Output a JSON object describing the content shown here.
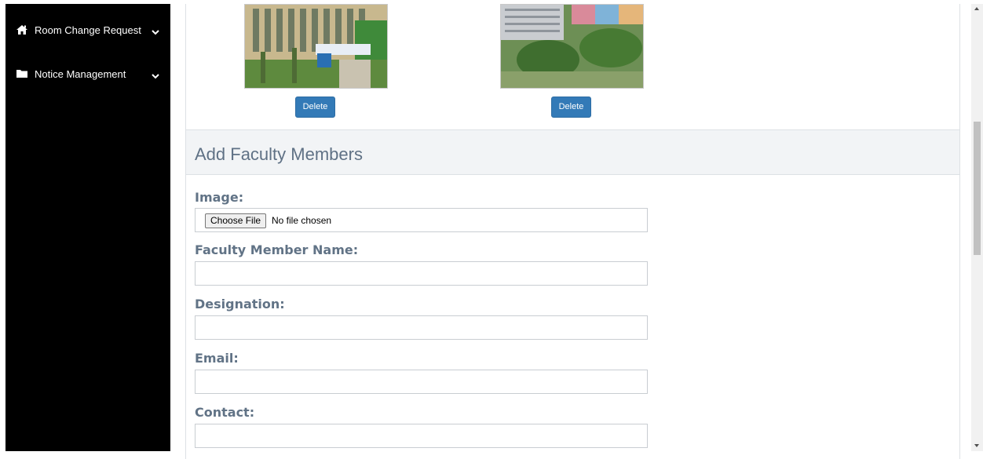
{
  "sidebar": {
    "items": [
      {
        "label": "Room Change Request",
        "icon": "home-icon"
      },
      {
        "label": "Notice Management",
        "icon": "folder-icon"
      }
    ]
  },
  "gallery": {
    "delete_label": "Delete"
  },
  "form": {
    "title": "Add Faculty Members",
    "image_label": "Image:",
    "choose_file_label": "Choose File",
    "no_file_text": "No file chosen",
    "name_label": "Faculty Member Name:",
    "designation_label": "Designation:",
    "email_label": "Email:",
    "contact_label": "Contact:"
  },
  "colors": {
    "sidebar_bg": "#000000",
    "accent": "#337ab7",
    "label": "#617386"
  }
}
